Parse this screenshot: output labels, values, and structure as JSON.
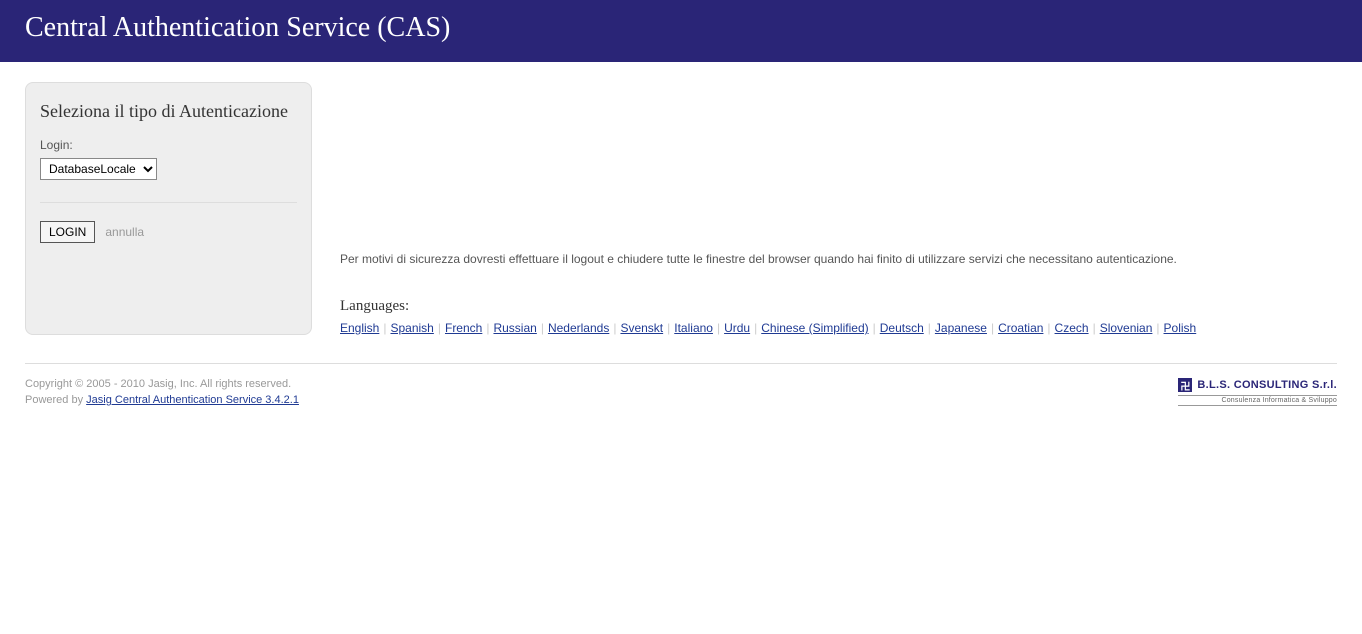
{
  "header": {
    "title": "Central Authentication Service (CAS)"
  },
  "login": {
    "heading": "Seleziona il tipo di Autenticazione",
    "label": "Login:",
    "selected_option": "DatabaseLocale",
    "submit_label": "LOGIN",
    "cancel_label": "annulla"
  },
  "security_note": "Per motivi di sicurezza dovresti effettuare il logout e chiudere tutte le finestre del browser quando hai finito di utilizzare servizi che necessitano autenticazione.",
  "languages": {
    "heading": "Languages:",
    "items": [
      "English",
      "Spanish",
      "French",
      "Russian",
      "Nederlands",
      "Svenskt",
      "Italiano",
      "Urdu",
      "Chinese (Simplified)",
      "Deutsch",
      "Japanese",
      "Croatian",
      "Czech",
      "Slovenian",
      "Polish"
    ]
  },
  "footer": {
    "copyright": "Copyright © 2005 - 2010 Jasig, Inc. All rights reserved.",
    "powered_prefix": "Powered by ",
    "powered_link": "Jasig Central Authentication Service 3.4.2.1",
    "logo_name": "B.L.S. CONSULTING S.r.l.",
    "logo_sub": "Consulenza Informatica & Sviluppo"
  }
}
